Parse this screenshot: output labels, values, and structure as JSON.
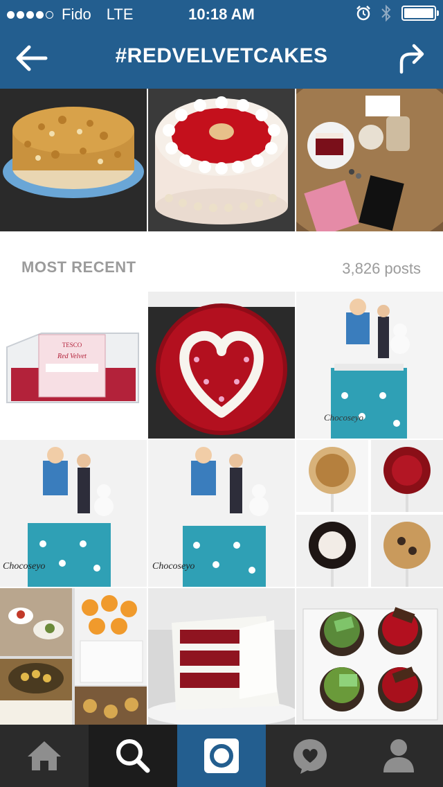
{
  "status": {
    "carrier": "Fido",
    "network": "LTE",
    "time": "10:18 AM"
  },
  "nav": {
    "title": "#REDVELVETCAKES"
  },
  "section": {
    "title": "MOST RECENT",
    "count": "3,826 posts"
  },
  "tabs": [
    "home",
    "search",
    "camera",
    "activity",
    "profile"
  ],
  "colors": {
    "brand": "#235e8f",
    "tabbar": "#2b2b2b",
    "muted": "#9b9b9b"
  }
}
